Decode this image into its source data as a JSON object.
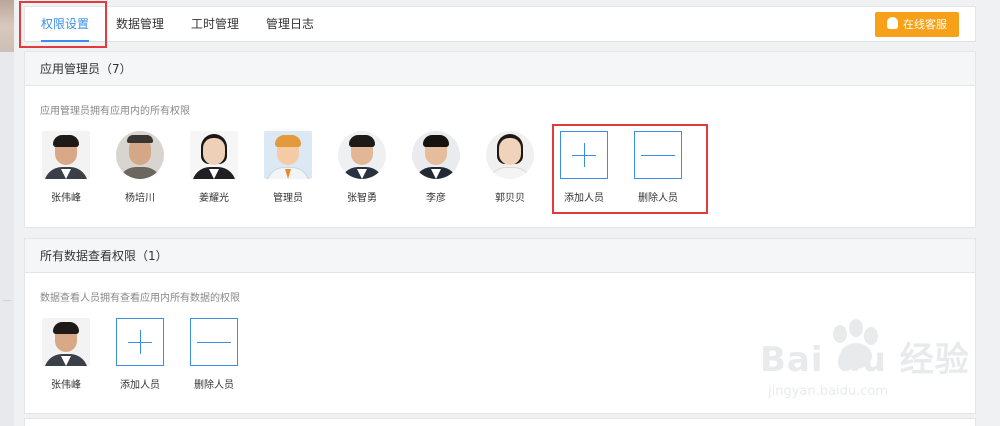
{
  "tabs": [
    {
      "label": "权限设置",
      "active": true
    },
    {
      "label": "数据管理",
      "active": false
    },
    {
      "label": "工时管理",
      "active": false
    },
    {
      "label": "管理日志",
      "active": false
    }
  ],
  "support_button": {
    "label": "在线客服",
    "icon": "qq-icon"
  },
  "app_admins": {
    "title": "应用管理员（7）",
    "description": "应用管理员拥有应用内的所有权限",
    "members": [
      "张伟峰",
      "杨培川",
      "姜耀光",
      "管理员",
      "张智勇",
      "李彦",
      "郭贝贝"
    ],
    "add_label": "添加人员",
    "remove_label": "删除人员"
  },
  "data_viewers": {
    "title": "所有数据查看权限（1）",
    "description": "数据查看人员拥有查看应用内所有数据的权限",
    "members": [
      "张伟峰"
    ],
    "add_label": "添加人员",
    "remove_label": "删除人员"
  },
  "watermark": {
    "brand": "Bai  du 经验",
    "url": "jingyan.baidu.com"
  },
  "colors": {
    "accent": "#3a8ee6",
    "support": "#f7a11a",
    "highlight": "#e23b3b"
  }
}
